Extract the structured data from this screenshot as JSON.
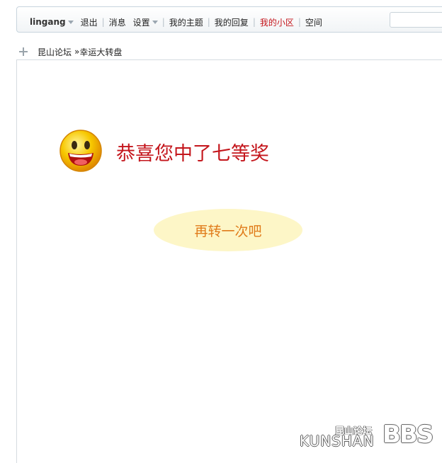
{
  "topbar": {
    "username": "lingang",
    "logout": "退出",
    "messages": "消息",
    "settings": "设置",
    "my_threads": "我的主题",
    "my_replies": "我的回复",
    "my_community": "我的小区",
    "space": "空间",
    "search_placeholder": ""
  },
  "breadcrumb": {
    "forum": "昆山论坛",
    "separator": "»",
    "page": "幸运大转盘"
  },
  "result": {
    "message": "恭喜您中了七等奖",
    "spin_again": "再转一次吧"
  },
  "logo": {
    "cn": "昆山论坛",
    "en": "KUNSHAN",
    "bbs": "BBS"
  },
  "colors": {
    "prize_text": "#c4161c",
    "active_nav": "#c4161c",
    "spin_button_bg": "#fdf6c7",
    "spin_button_text": "#e07b1a"
  }
}
